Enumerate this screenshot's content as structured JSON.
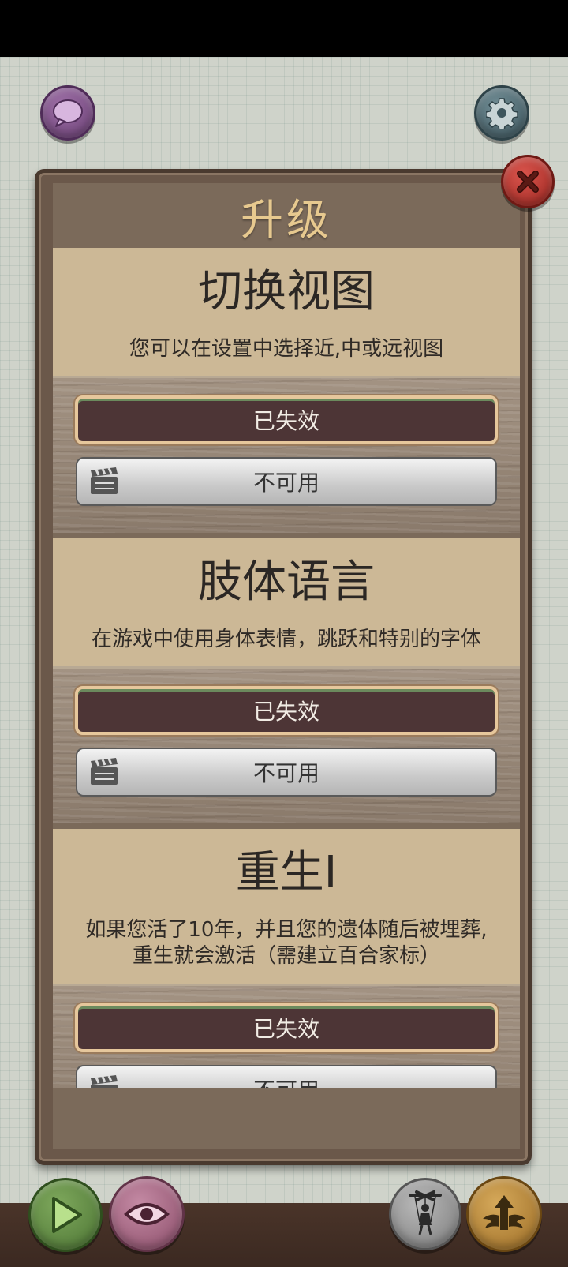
{
  "panel": {
    "title": "升级"
  },
  "upgrades": [
    {
      "name": "切换视图",
      "description": [
        "您可以在设置中选择近,中或远视图"
      ],
      "status_label": "已失效",
      "video_label": "不可用"
    },
    {
      "name": "肢体语言",
      "description": [
        "在游戏中使用身体表情，跳跃和特别的字体"
      ],
      "status_label": "已失效",
      "video_label": "不可用"
    },
    {
      "name": "重生I",
      "description": [
        "如果您活了10年，并且您的遗体随后被埋葬,",
        "重生就会激活（需建立百合家标）"
      ],
      "status_label": "已失效",
      "video_label": "不可用"
    }
  ],
  "icons": {
    "chat": "speech-bubble-icon",
    "settings": "gear-icon",
    "close": "close-x-icon",
    "play": "play-icon",
    "view": "eye-icon",
    "character": "puppet-icon",
    "upgrade": "wings-arrow-icon",
    "video": "clapperboard-icon"
  },
  "colors": {
    "background": "#cfd3ca",
    "panel_frame": "#6b584a",
    "card": "#ccb896",
    "title": "#e7c98f",
    "disabled_button": "#4d3536",
    "close_button": "#c0392b"
  }
}
